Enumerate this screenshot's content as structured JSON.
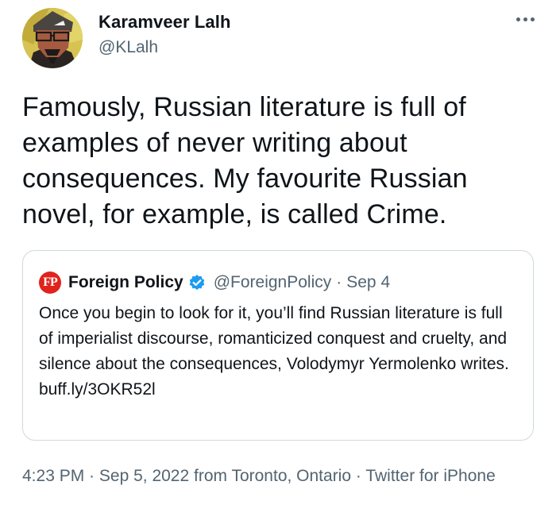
{
  "author": {
    "display_name": "Karamveer Lalh",
    "handle": "@KLalh"
  },
  "more_icon": "more-horizontal-icon",
  "tweet": {
    "text": "Famously, Russian literature is full of examples of never writing about consequences. My favourite Russian novel, for example, is called Crime."
  },
  "quote": {
    "logo_text": "FP",
    "logo_color": "#e0231c",
    "display_name": "Foreign Policy",
    "verified_icon": "verified-badge-icon",
    "verified_color": "#1d9bf0",
    "handle": "@ForeignPolicy",
    "separator": "·",
    "date": "Sep 4",
    "text": "Once you begin to look for it, you’ll find Russian literature is full of imperialist discourse, romanticized conquest and cruelty, and silence about the consequences, Volodymyr Yermolenko writes.",
    "link": "buff.ly/3OKR52l"
  },
  "meta": {
    "time": "4:23 PM",
    "sep1": " · ",
    "date": "Sep 5, 2022",
    "from": " from ",
    "location": "Toronto, Ontario",
    "sep2": " · ",
    "source": "Twitter for iPhone"
  },
  "colors": {
    "text": "#0f1419",
    "secondary": "#536471",
    "border": "#cfd9de"
  }
}
